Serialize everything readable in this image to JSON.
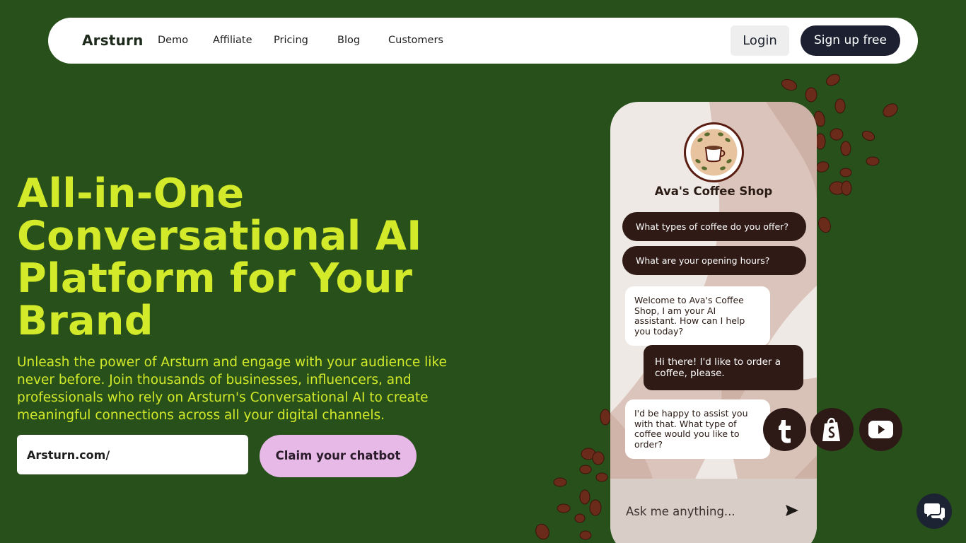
{
  "nav": {
    "brand": "Arsturn",
    "links": [
      "Demo",
      "Affiliate",
      "Pricing",
      "Blog",
      "Customers"
    ],
    "login": "Login",
    "signup": "Sign up free"
  },
  "hero": {
    "title": "All-in-One Conversational AI Platform for Your Brand",
    "subtitle": "Unleash the power of Arsturn and engage with your audience like never before. Join thousands of businesses, influencers, and professionals who rely on Arsturn's Conversational AI to create meaningful connections across all your digital channels.",
    "url_value": "Arsturn.com/",
    "cta": "Claim your chatbot"
  },
  "demo_chat": {
    "shop_name": "Ava's Coffee Shop",
    "quick_replies": [
      "What types of coffee do you offer?",
      "What are your opening hours?"
    ],
    "messages": [
      {
        "from": "bot",
        "text": "Welcome to Ava's Coffee Shop, I am your AI assistant. How can I help you today?"
      },
      {
        "from": "user",
        "text": "Hi there! I'd like to order a coffee, please."
      },
      {
        "from": "bot",
        "text": "I'd be happy to assist you with that. What type of coffee would you like to order?"
      }
    ],
    "input_placeholder": "Ask me anything..."
  },
  "social_icons": [
    "tumblr-icon",
    "shopify-icon",
    "youtube-icon"
  ],
  "colors": {
    "background": "#27501b",
    "accent": "#d2ea2a",
    "cta": "#e6b9e6",
    "dark": "#1c2030",
    "coffee": "#2f1a16"
  }
}
